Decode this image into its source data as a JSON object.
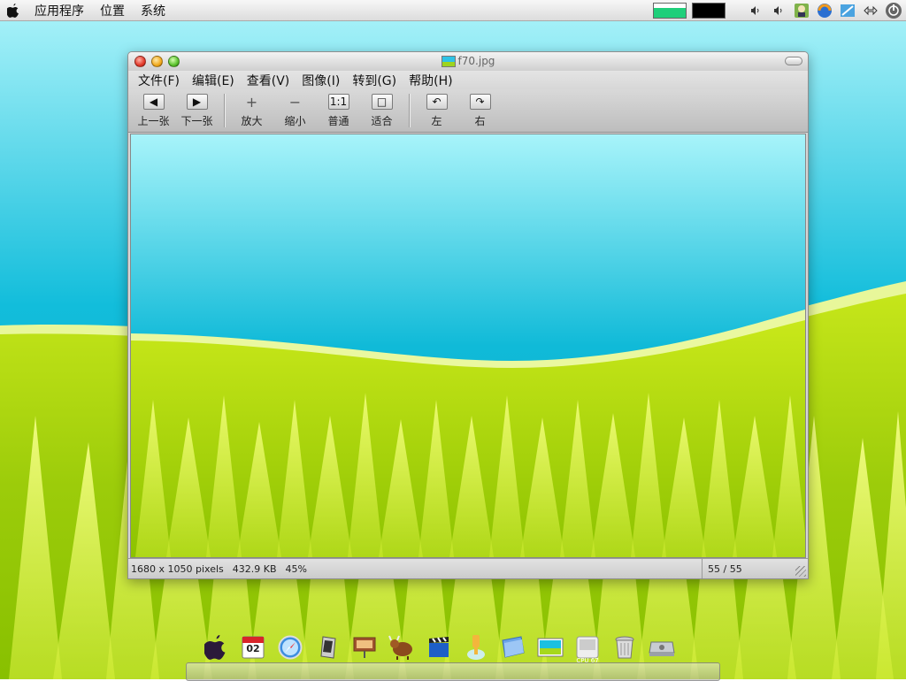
{
  "panel": {
    "menus": [
      "应用程序",
      "位置",
      "系统"
    ],
    "tray_icons": [
      "volume-icon",
      "volume-icon-2",
      "user-icon",
      "browser-icon",
      "network-app-icon",
      "network-arrows-icon",
      "power-icon"
    ]
  },
  "window": {
    "title": "f70.jpg",
    "menu": [
      "文件(F)",
      "编辑(E)",
      "查看(V)",
      "图像(I)",
      "转到(G)",
      "帮助(H)"
    ],
    "toolbar": {
      "prev": {
        "icon": "◀",
        "label": "上一张"
      },
      "next": {
        "icon": "▶",
        "label": "下一张"
      },
      "zoom_in": {
        "icon": "+",
        "label": "放大"
      },
      "zoom_out": {
        "icon": "−",
        "label": "缩小"
      },
      "normal": {
        "icon": "1:1",
        "label": "普通"
      },
      "fit": {
        "icon": "□",
        "label": "适合"
      },
      "rotate_left": {
        "icon": "↶",
        "label": "左"
      },
      "rotate_right": {
        "icon": "↷",
        "label": "右"
      }
    },
    "status": {
      "dimensions": "1680 x 1050 pixels",
      "size": "432.9 KB",
      "zoom": "45%",
      "position": "55 / 55"
    }
  },
  "dock": {
    "items": [
      "apple-icon",
      "calendar-icon",
      "safari-icon",
      "terminal-icon",
      "presentation-icon",
      "gnu-icon",
      "clapper-icon",
      "lamp-icon",
      "folder-icon",
      "image-viewer-icon",
      "cpu-monitor-icon",
      "trash-icon",
      "drive-icon"
    ],
    "calendar_date": "02",
    "cpu_label": "CPU 67"
  },
  "colors": {
    "sky_top": "#a6f3f8",
    "sky_bottom": "#0bb4d4",
    "grass_light": "#dcef3a",
    "grass_dark": "#7fb800"
  }
}
